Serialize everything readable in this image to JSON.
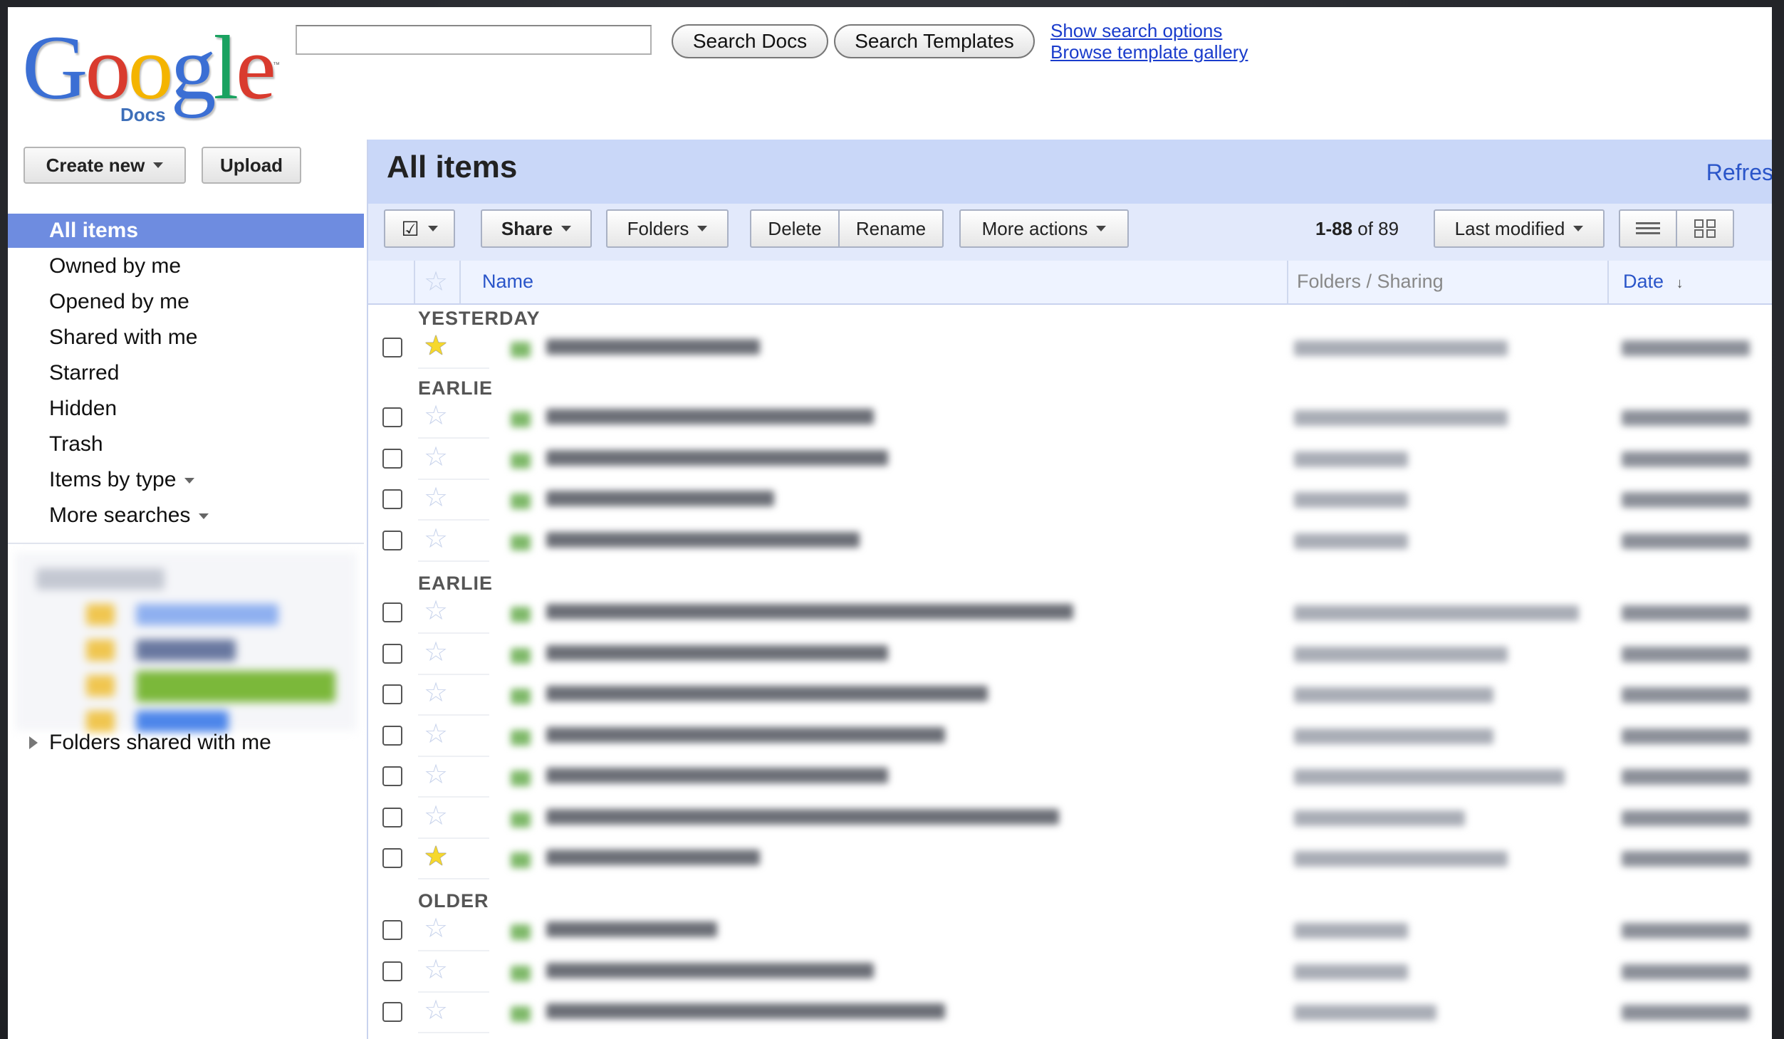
{
  "logo": {
    "wordmark": [
      "G",
      "o",
      "o",
      "g",
      "l",
      "e"
    ],
    "wordmark_colors": [
      "#3b6fd4",
      "#d93b2e",
      "#f4b400",
      "#3b6fd4",
      "#1aa260",
      "#d93b2e"
    ],
    "sub": "Docs",
    "tm": "™"
  },
  "search": {
    "value": "",
    "search_docs_label": "Search Docs",
    "search_templates_label": "Search Templates",
    "show_options_link": "Show search options",
    "browse_gallery_link": "Browse template gallery"
  },
  "sidebar": {
    "create_new_label": "Create new",
    "upload_label": "Upload",
    "items": [
      {
        "label": "All items",
        "active": true
      },
      {
        "label": "Owned by me",
        "active": false
      },
      {
        "label": "Opened by me",
        "active": false
      },
      {
        "label": "Shared with me",
        "active": false
      },
      {
        "label": "Starred",
        "active": false
      },
      {
        "label": "Hidden",
        "active": false
      },
      {
        "label": "Trash",
        "active": false
      },
      {
        "label": "Items by type",
        "active": false,
        "dropdown": true
      },
      {
        "label": "More searches",
        "active": false,
        "dropdown": true
      }
    ],
    "folders_shared_label": "Folders shared with me"
  },
  "main": {
    "title": "All items",
    "refresh_label": "Refres",
    "toolbar": {
      "select_glyph": "☑",
      "share_label": "Share",
      "folders_label": "Folders",
      "delete_label": "Delete",
      "rename_label": "Rename",
      "more_actions_label": "More actions",
      "range_bold": "1-88",
      "range_rest": " of 89",
      "sort_label": "Last modified"
    },
    "columns": {
      "name": "Name",
      "folders_sharing": "Folders / Sharing",
      "date": "Date",
      "date_sort_glyph": "↓"
    },
    "groups": [
      {
        "label": "YESTERDAY",
        "rows": [
          true
        ]
      },
      {
        "label": "EARLIE",
        "rows": [
          false,
          false,
          false,
          false
        ]
      },
      {
        "label": "EARLIE",
        "rows": [
          false,
          false,
          false,
          false,
          false,
          false,
          true
        ]
      },
      {
        "label": "OLDER",
        "rows": [
          false,
          false,
          false
        ]
      }
    ]
  },
  "colors": {
    "accent": "#6e8ce0",
    "title_bar": "#c9d7f8",
    "toolbar_bg": "#e2e9fb",
    "link": "#1a3ccc",
    "star_on": "#f6d82c"
  }
}
